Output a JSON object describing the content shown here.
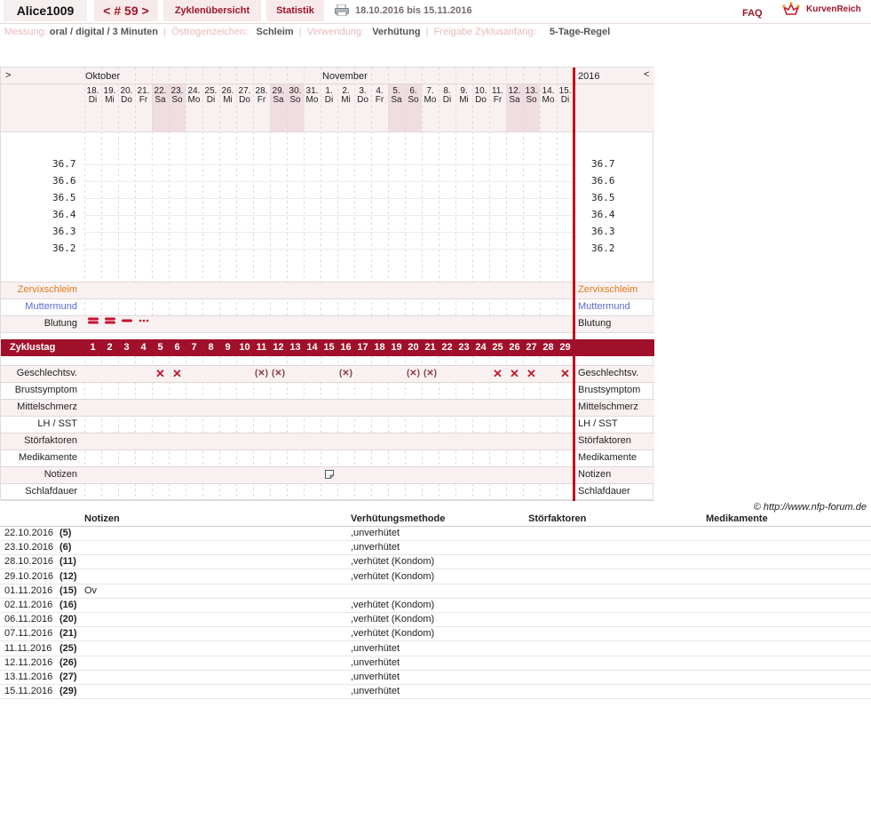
{
  "header": {
    "user": "Alice1009",
    "cycle": "< # 59 >",
    "overview": "Zyklenübersicht",
    "stats": "Statistik",
    "date_range": "18.10.2016 bis 15.11.2016",
    "faq": "FAQ",
    "logo": "KurvenReich",
    "accent": "#a0152a"
  },
  "meta": {
    "messung_label": "Messung:",
    "messung_value": "oral / digital / 3 Minuten",
    "oestrogen_label": "Östrogenzeichen:",
    "oestrogen_value": "Schleim",
    "verwendung_label": "Verwendung:",
    "verwendung_value": "Verhütung",
    "freigabe_label": "Freigabe Zyklusanfang:",
    "freigabe_value": "5-Tage-Regel"
  },
  "chart": {
    "nav_left": ">",
    "nav_right": "<",
    "year": "2016",
    "months": [
      "Oktober",
      "November"
    ],
    "days": [
      {
        "d": "18.",
        "w": "Di"
      },
      {
        "d": "19.",
        "w": "Mi"
      },
      {
        "d": "20.",
        "w": "Do"
      },
      {
        "d": "21.",
        "w": "Fr"
      },
      {
        "d": "22.",
        "w": "Sa",
        "we": true
      },
      {
        "d": "23.",
        "w": "So",
        "we": true
      },
      {
        "d": "24.",
        "w": "Mo"
      },
      {
        "d": "25.",
        "w": "Di"
      },
      {
        "d": "26.",
        "w": "Mi"
      },
      {
        "d": "27.",
        "w": "Do"
      },
      {
        "d": "28.",
        "w": "Fr"
      },
      {
        "d": "29.",
        "w": "Sa",
        "we": true
      },
      {
        "d": "30.",
        "w": "So",
        "we": true
      },
      {
        "d": "31.",
        "w": "Mo"
      },
      {
        "d": "1.",
        "w": "Di"
      },
      {
        "d": "2.",
        "w": "Mi"
      },
      {
        "d": "3.",
        "w": "Do"
      },
      {
        "d": "4.",
        "w": "Fr"
      },
      {
        "d": "5.",
        "w": "Sa",
        "we": true
      },
      {
        "d": "6.",
        "w": "So",
        "we": true
      },
      {
        "d": "7.",
        "w": "Mo"
      },
      {
        "d": "8.",
        "w": "Di"
      },
      {
        "d": "9.",
        "w": "Mi"
      },
      {
        "d": "10.",
        "w": "Do"
      },
      {
        "d": "11.",
        "w": "Fr"
      },
      {
        "d": "12.",
        "w": "Sa",
        "we": true
      },
      {
        "d": "13.",
        "w": "So",
        "we": true
      },
      {
        "d": "14.",
        "w": "Mo"
      },
      {
        "d": "15.",
        "w": "Di"
      }
    ],
    "temp_ticks": [
      "36.7",
      "36.6",
      "36.5",
      "36.4",
      "36.3",
      "36.2"
    ],
    "labels": {
      "zervix": "Zervixschleim",
      "muttermund": "Muttermund",
      "blutung": "Blutung",
      "zyklustag": "Zyklustag",
      "gv": "Geschlechtsv.",
      "brust": "Brustsymptom",
      "mittel": "Mittelschmerz",
      "lh": "LH / SST",
      "stoer": "Störfaktoren",
      "medi": "Medikamente",
      "notizen": "Notizen",
      "schlaf": "Schlafdauer"
    },
    "zervix_color": "#e07a1a",
    "muttermund_color": "#5a6ad0",
    "cycle_days": [
      "1",
      "2",
      "3",
      "4",
      "5",
      "6",
      "7",
      "8",
      "9",
      "10",
      "11",
      "12",
      "13",
      "14",
      "15",
      "16",
      "17",
      "18",
      "19",
      "20",
      "21",
      "22",
      "23",
      "24",
      "25",
      "26",
      "27",
      "28",
      "29"
    ],
    "bleeding": [
      {
        "day": 1,
        "level": "strong"
      },
      {
        "day": 2,
        "level": "strong"
      },
      {
        "day": 3,
        "level": "medium"
      },
      {
        "day": 4,
        "level": "spotting"
      }
    ],
    "intercourse": [
      {
        "day": 5,
        "sym": "✕",
        "kind": "sx"
      },
      {
        "day": 6,
        "sym": "✕",
        "kind": "sx"
      },
      {
        "day": 11,
        "sym": "(✕)",
        "kind": "pr"
      },
      {
        "day": 12,
        "sym": "(✕)",
        "kind": "pr"
      },
      {
        "day": 16,
        "sym": "(✕)",
        "kind": "pr"
      },
      {
        "day": 20,
        "sym": "(✕)",
        "kind": "pr"
      },
      {
        "day": 21,
        "sym": "(✕)",
        "kind": "pr"
      },
      {
        "day": 25,
        "sym": "✕",
        "kind": "sx"
      },
      {
        "day": 26,
        "sym": "✕",
        "kind": "sx"
      },
      {
        "day": 27,
        "sym": "✕",
        "kind": "sx"
      },
      {
        "day": 29,
        "sym": "✕",
        "kind": "sx"
      }
    ],
    "note_day": 15,
    "note_icon": "note-icon"
  },
  "copyright": "© http://www.nfp-forum.de",
  "notes": {
    "headers": {
      "notizen": "Notizen",
      "verhuetung": "Verhütungsmethode",
      "stoer": "Störfaktoren",
      "medi": "Medikamente"
    },
    "rows": [
      {
        "date": "22.10.2016",
        "day": "(5)",
        "note": "",
        "method": ",unverhütet"
      },
      {
        "date": "23.10.2016",
        "day": "(6)",
        "note": "",
        "method": ",unverhütet"
      },
      {
        "date": "28.10.2016",
        "day": "(11)",
        "note": "",
        "method": ",verhütet (Kondom)"
      },
      {
        "date": "29.10.2016",
        "day": "(12)",
        "note": "",
        "method": ",verhütet (Kondom)"
      },
      {
        "date": "01.11.2016",
        "day": "(15)",
        "note": "Ov",
        "method": ""
      },
      {
        "date": "02.11.2016",
        "day": "(16)",
        "note": "",
        "method": ",verhütet (Kondom)"
      },
      {
        "date": "06.11.2016",
        "day": "(20)",
        "note": "",
        "method": ",verhütet (Kondom)"
      },
      {
        "date": "07.11.2016",
        "day": "(21)",
        "note": "",
        "method": ",verhütet (Kondom)"
      },
      {
        "date": "11.11.2016",
        "day": "(25)",
        "note": "",
        "method": ",unverhütet"
      },
      {
        "date": "12.11.2016",
        "day": "(26)",
        "note": "",
        "method": ",unverhütet"
      },
      {
        "date": "13.11.2016",
        "day": "(27)",
        "note": "",
        "method": ",unverhütet"
      },
      {
        "date": "15.11.2016",
        "day": "(29)",
        "note": "",
        "method": ",unverhütet"
      }
    ]
  }
}
